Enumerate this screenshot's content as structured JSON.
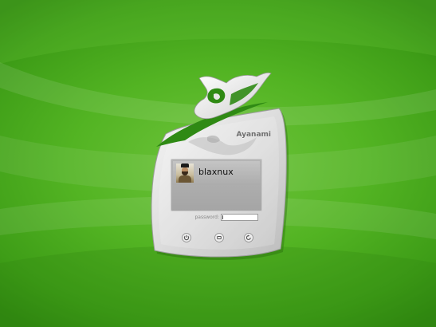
{
  "window": {
    "title": ""
  },
  "greeter": {
    "hostname": "Ayanami",
    "user": {
      "name": "blaxnux",
      "avatar_icon": "user-avatar-photo"
    },
    "password": {
      "label": "password:",
      "value": ""
    },
    "actions": [
      {
        "name": "shutdown",
        "icon": "power-icon"
      },
      {
        "name": "session",
        "icon": "session-icon"
      },
      {
        "name": "restart",
        "icon": "restart-icon"
      }
    ]
  },
  "colors": {
    "background": "#53b423",
    "panel_light": "#f2f2f2",
    "panel_dark": "#8a8a8a",
    "emblem_green": "#2f8a14"
  }
}
